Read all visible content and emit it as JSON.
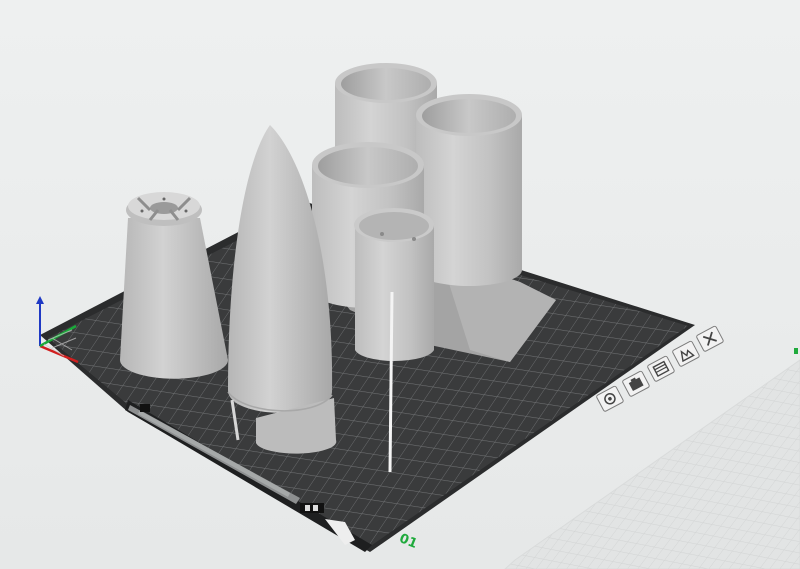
{
  "viewport": {
    "background": "#e9ebeb",
    "plate_color": "#3a3b3c",
    "grid_color": "#6a6c6e",
    "model_color": "#c4c4c4",
    "accent_green": "#1faa3c"
  },
  "plate": {
    "number": "01",
    "buttons": [
      {
        "icon": "orient-icon"
      },
      {
        "icon": "arrange-icon"
      },
      {
        "icon": "slice-plate-icon"
      },
      {
        "icon": "plate-settings-icon"
      },
      {
        "icon": "close-icon"
      }
    ]
  },
  "axes": {
    "x_color": "#d11f1f",
    "y_color": "#1aa93a",
    "z_color": "#1f39c4"
  }
}
